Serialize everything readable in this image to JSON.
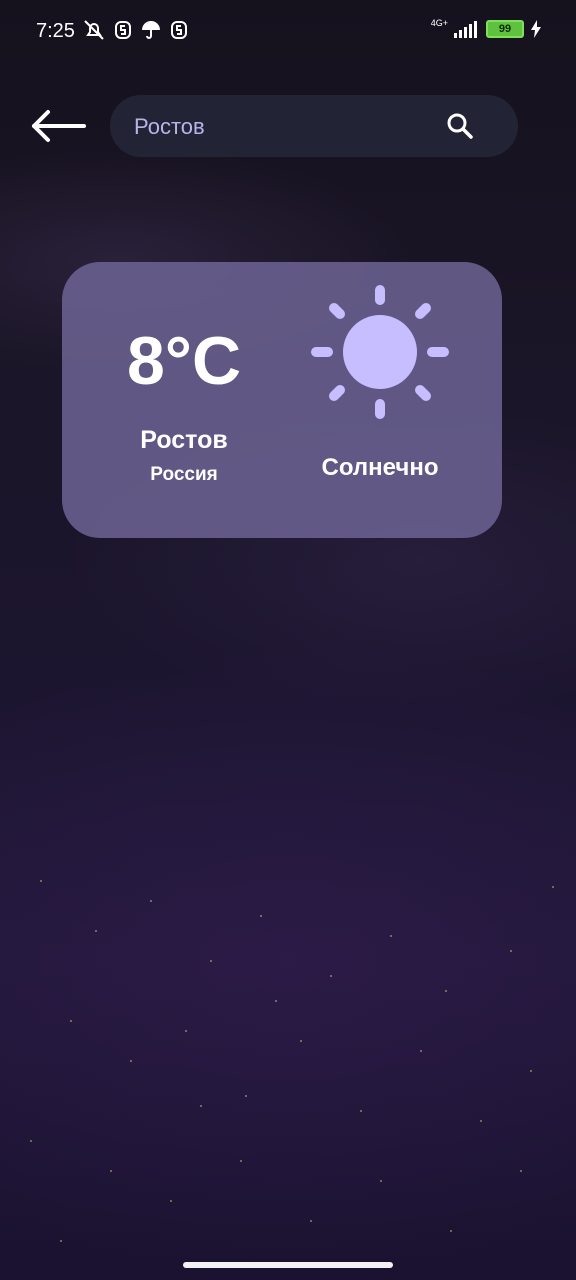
{
  "status_bar": {
    "time": "7:25",
    "network": "4G+",
    "battery": "99",
    "left_icons": [
      "bell-off-icon",
      "s-notification-icon",
      "umbrella-icon",
      "s-notification-icon"
    ],
    "right_icons": [
      "signal-icon",
      "battery-icon",
      "charging-icon"
    ]
  },
  "header": {
    "back_icon": "arrow-left-icon",
    "search": {
      "value": "Ростов",
      "icon": "search-icon"
    }
  },
  "weather_card": {
    "temperature": "8°C",
    "city": "Ростов",
    "country": "Россия",
    "condition": "Солнечно",
    "condition_icon": "sun-icon"
  },
  "colors": {
    "card_bg": "#7066a0",
    "sun": "#c6beff",
    "search_text": "#b9b3e8"
  }
}
